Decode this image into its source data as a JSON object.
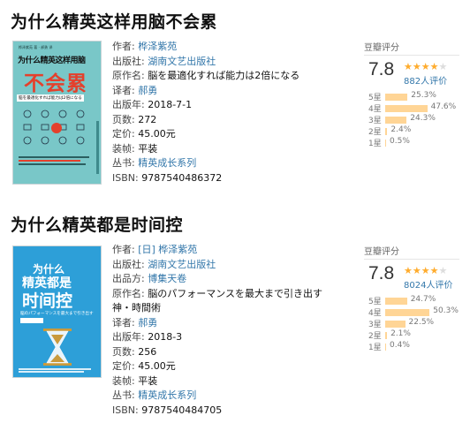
{
  "books": [
    {
      "title": "为什么精英这样用脑不会累",
      "cover": {
        "top": "为什么精英这样用脑",
        "main": "不会累",
        "sub": "脑を最適化すれば能力は2倍になる",
        "bg": "#79c7c8",
        "accent": "#e4402c"
      },
      "fields": [
        {
          "label": "作者:",
          "value": "桦泽紫苑",
          "link": true
        },
        {
          "label": "出版社:",
          "value": "湖南文艺出版社",
          "link": true
        },
        {
          "label": "原作名:",
          "value": "脳を最適化すれば能力は2倍になる",
          "link": false
        },
        {
          "label": "译者:",
          "value": "郝勇",
          "link": true
        },
        {
          "label": "出版年:",
          "value": "2018-7-1",
          "link": false
        },
        {
          "label": "页数:",
          "value": "272",
          "link": false
        },
        {
          "label": "定价:",
          "value": "45.00元",
          "link": false
        },
        {
          "label": "装帧:",
          "value": "平装",
          "link": false
        },
        {
          "label": "丛书:",
          "value": "精英成长系列",
          "link": true
        },
        {
          "label": "ISBN:",
          "value": "9787540486372",
          "link": false
        }
      ],
      "rating": {
        "label": "豆瓣评分",
        "score": "7.8",
        "stars": 4,
        "count": "882人评价",
        "dist": [
          {
            "star": "5星",
            "pct": "25.3%",
            "value": 25.3
          },
          {
            "star": "4星",
            "pct": "47.6%",
            "value": 47.6
          },
          {
            "star": "3星",
            "pct": "24.3%",
            "value": 24.3
          },
          {
            "star": "2星",
            "pct": "2.4%",
            "value": 2.4
          },
          {
            "star": "1星",
            "pct": "0.5%",
            "value": 0.5
          }
        ]
      }
    },
    {
      "title": "为什么精英都是时间控",
      "cover": {
        "top": "为什么",
        "mid": "精英都是",
        "main": "时间控",
        "sub": "脳のパフォーマンスを最大まで引き出す",
        "bg": "#2d9fd8",
        "accent": "#c99a3c"
      },
      "fields": [
        {
          "label": "作者:",
          "value": "[日] 桦泽紫苑",
          "link": true
        },
        {
          "label": "出版社:",
          "value": "湖南文艺出版社",
          "link": true
        },
        {
          "label": "出品方:",
          "value": "博集天卷",
          "link": true
        },
        {
          "label": "原作名:",
          "value": "脳のパフォーマンスを最大まで引き出す 神・時間術",
          "link": false
        },
        {
          "label": "译者:",
          "value": "郝勇",
          "link": true
        },
        {
          "label": "出版年:",
          "value": "2018-3",
          "link": false
        },
        {
          "label": "页数:",
          "value": "256",
          "link": false
        },
        {
          "label": "定价:",
          "value": "45.00元",
          "link": false
        },
        {
          "label": "装帧:",
          "value": "平装",
          "link": false
        },
        {
          "label": "丛书:",
          "value": "精英成长系列",
          "link": true
        },
        {
          "label": "ISBN:",
          "value": "9787540484705",
          "link": false
        }
      ],
      "rating": {
        "label": "豆瓣评分",
        "score": "7.8",
        "stars": 4,
        "count": "8024人评价",
        "dist": [
          {
            "star": "5星",
            "pct": "24.7%",
            "value": 24.7
          },
          {
            "star": "4星",
            "pct": "50.3%",
            "value": 50.3
          },
          {
            "star": "3星",
            "pct": "22.5%",
            "value": 22.5
          },
          {
            "star": "2星",
            "pct": "2.1%",
            "value": 2.1
          },
          {
            "star": "1星",
            "pct": "0.4%",
            "value": 0.4
          }
        ]
      }
    }
  ]
}
